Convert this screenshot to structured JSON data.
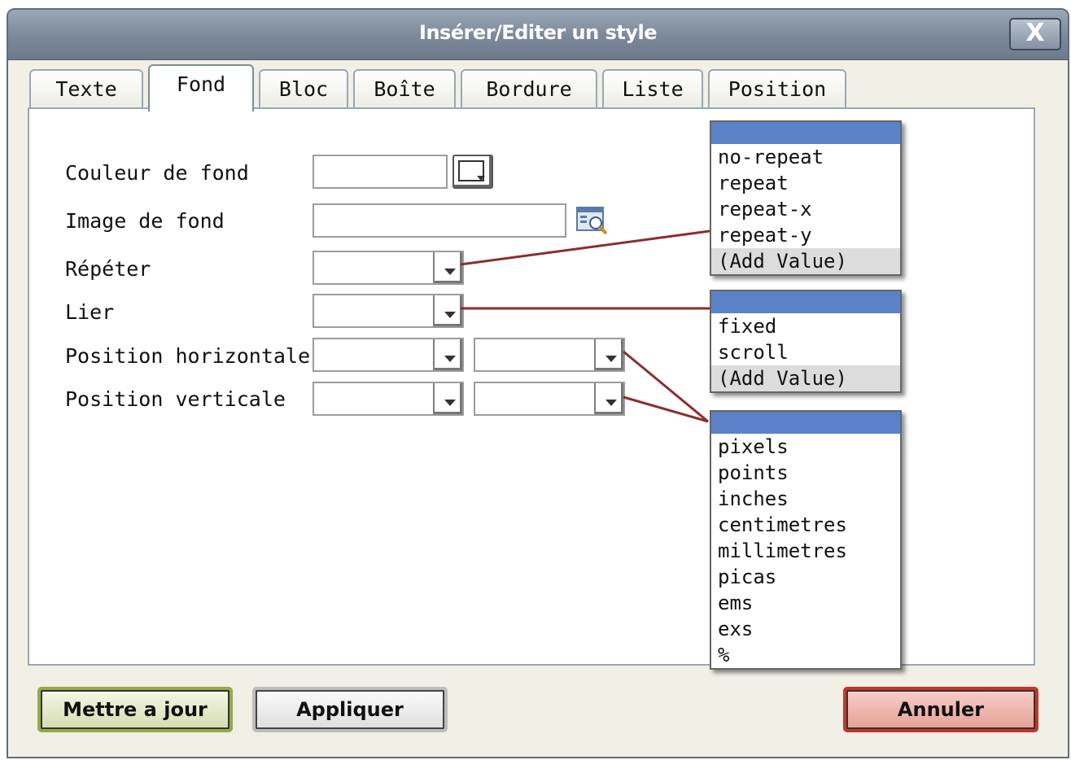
{
  "dialog": {
    "title": "Insérer/Editer un style",
    "close_label": "X"
  },
  "tabs": [
    {
      "label": "Texte"
    },
    {
      "label": "Fond",
      "active": true
    },
    {
      "label": "Bloc"
    },
    {
      "label": "Boîte"
    },
    {
      "label": "Bordure"
    },
    {
      "label": "Liste"
    },
    {
      "label": "Position"
    }
  ],
  "form": {
    "background_color": {
      "label": "Couleur de fond",
      "value": ""
    },
    "background_image": {
      "label": "Image de fond",
      "value": ""
    },
    "repeat": {
      "label": "Répéter",
      "value": ""
    },
    "attachment": {
      "label": "Lier",
      "value": ""
    },
    "horizontal_position": {
      "label": "Position horizontale",
      "value": "",
      "unit": ""
    },
    "vertical_position": {
      "label": "Position verticale",
      "value": "",
      "unit": ""
    }
  },
  "dropdowns": {
    "repeat_options": [
      "no-repeat",
      "repeat",
      "repeat-x",
      "repeat-y",
      "(Add Value)"
    ],
    "attachment_options": [
      "fixed",
      "scroll",
      "(Add Value)"
    ],
    "unit_options": [
      "pixels",
      "points",
      "inches",
      "centimetres",
      "millimetres",
      "picas",
      "ems",
      "exs",
      "%"
    ]
  },
  "buttons": {
    "update": "Mettre a jour",
    "apply": "Appliquer",
    "cancel": "Annuler"
  },
  "colors": {
    "titlebar": "#7a8899",
    "selection": "#5b82c8",
    "connector": "#8b2e2e",
    "cancel_border": "#c2362b",
    "update_border": "#95aa49"
  },
  "icons": [
    "close-icon",
    "color-picker-icon",
    "browse-image-icon",
    "chevron-down-icon"
  ]
}
